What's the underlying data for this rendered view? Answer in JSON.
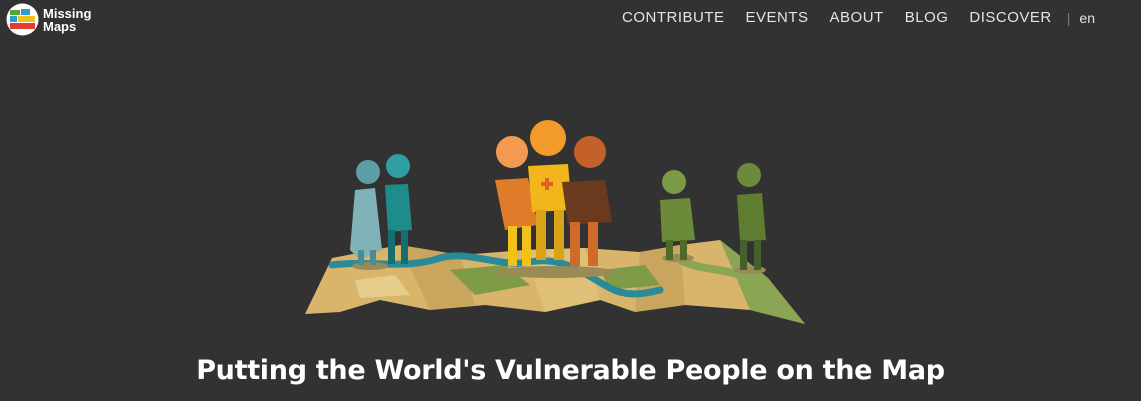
{
  "brand": {
    "logo_line1": "Missing",
    "logo_line2": "Maps",
    "colors": {
      "green": "#5aa23a",
      "blue": "#2b9cd8",
      "yellow": "#f2c21b",
      "red": "#e03b36"
    }
  },
  "nav": {
    "items": [
      {
        "label": "CONTRIBUTE"
      },
      {
        "label": "EVENTS"
      },
      {
        "label": "ABOUT"
      },
      {
        "label": "BLOG"
      },
      {
        "label": "DISCOVER"
      }
    ],
    "separator": "|",
    "language": "en"
  },
  "hero": {
    "illustration_icon": "people-on-map-illustration",
    "headline": "Putting the World's Vulnerable People on the Map"
  },
  "theme": {
    "background": "#323232",
    "nav_text": "#e4e4e4",
    "headline_text": "#ffffff"
  }
}
